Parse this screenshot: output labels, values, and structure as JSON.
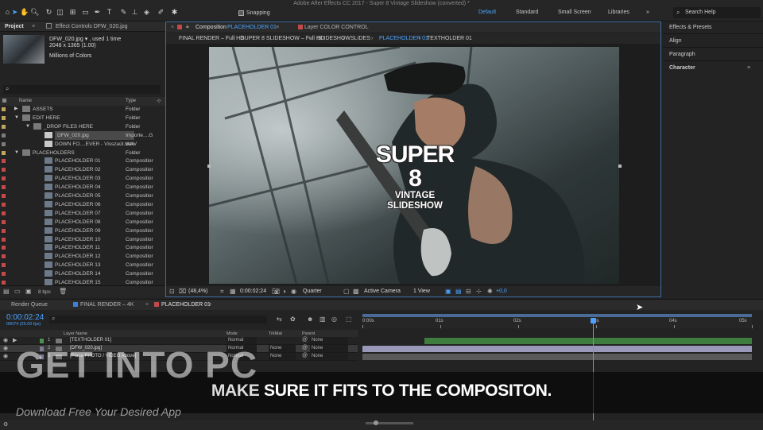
{
  "app": {
    "title": "Adobe After Effects CC 2017 - Super 8 Vintage Slideshow (converted) *"
  },
  "toolbar": {
    "snapping": "Snapping",
    "workspaces": [
      "Default",
      "Standard",
      "Small Screen",
      "Libraries"
    ],
    "search_placeholder": "Search Help"
  },
  "project": {
    "tab": "Project",
    "effect_controls": "Effect Controls DFW_020.jpg",
    "thumb_name": "DFW_020.jpg ▾ , used 1 time",
    "thumb_dims": "2048 x 1365 (1.00)",
    "thumb_colors": "Millions of Colors",
    "col_name": "Name",
    "col_type": "Type",
    "bpc": "8 bpc",
    "items": [
      {
        "name": "ASSETS",
        "type": "Folder",
        "label": "#c0a85a",
        "kind": "folder",
        "indent": 0
      },
      {
        "name": "EDIT HERE",
        "type": "Folder",
        "label": "#c0a85a",
        "kind": "folder",
        "indent": 0
      },
      {
        "name": "_DROP FILES HERE",
        "type": "Folder",
        "label": "#c0a85a",
        "kind": "folder",
        "indent": 1
      },
      {
        "name": "DFW_020.jpg",
        "type": "Importe....G",
        "label": "#7d7d7d",
        "kind": "file",
        "indent": 2
      },
      {
        "name": "DOWN FO....EVER - Visszaút.wav",
        "type": "WAV",
        "label": "#7d7d7d",
        "kind": "file",
        "indent": 2
      },
      {
        "name": "PLACEHOLDERS",
        "type": "Folder",
        "label": "#c0a85a",
        "kind": "folder",
        "indent": 0
      },
      {
        "name": "PLACEHOLDER 01",
        "type": "Compositior",
        "label": "#c44a4a",
        "kind": "comp",
        "indent": 2
      },
      {
        "name": "PLACEHOLDER 02",
        "type": "Compositior",
        "label": "#c44a4a",
        "kind": "comp",
        "indent": 2
      },
      {
        "name": "PLACEHOLDER 03",
        "type": "Compositior",
        "label": "#c44a4a",
        "kind": "comp",
        "indent": 2
      },
      {
        "name": "PLACEHOLDER 04",
        "type": "Compositior",
        "label": "#c44a4a",
        "kind": "comp",
        "indent": 2
      },
      {
        "name": "PLACEHOLDER 05",
        "type": "Compositior",
        "label": "#c44a4a",
        "kind": "comp",
        "indent": 2
      },
      {
        "name": "PLACEHOLDER 06",
        "type": "Compositior",
        "label": "#c44a4a",
        "kind": "comp",
        "indent": 2
      },
      {
        "name": "PLACEHOLDER 07",
        "type": "Compositior",
        "label": "#c44a4a",
        "kind": "comp",
        "indent": 2
      },
      {
        "name": "PLACEHOLDER 08",
        "type": "Compositior",
        "label": "#c44a4a",
        "kind": "comp",
        "indent": 2
      },
      {
        "name": "PLACEHOLDER 09",
        "type": "Compositior",
        "label": "#c44a4a",
        "kind": "comp",
        "indent": 2
      },
      {
        "name": "PLACEHOLDER 10",
        "type": "Compositior",
        "label": "#c44a4a",
        "kind": "comp",
        "indent": 2
      },
      {
        "name": "PLACEHOLDER 11",
        "type": "Compositior",
        "label": "#c44a4a",
        "kind": "comp",
        "indent": 2
      },
      {
        "name": "PLACEHOLDER 12",
        "type": "Compositior",
        "label": "#c44a4a",
        "kind": "comp",
        "indent": 2
      },
      {
        "name": "PLACEHOLDER 13",
        "type": "Compositior",
        "label": "#c44a4a",
        "kind": "comp",
        "indent": 2
      },
      {
        "name": "PLACEHOLDER 14",
        "type": "Compositior",
        "label": "#c44a4a",
        "kind": "comp",
        "indent": 2
      },
      {
        "name": "PLACEHOLDER 15",
        "type": "Compositior",
        "label": "#c44a4a",
        "kind": "comp",
        "indent": 2
      }
    ]
  },
  "viewer": {
    "comp_tab_prefix": "Composition",
    "comp_tab_name": "PLACEHOLDER 01",
    "layer_tab": "Layer COLOR CONTROL",
    "breadcrumbs": [
      "FINAL RENDER – Full HD",
      "SUPER 8 SLIDESHOW – Full HD",
      "SLIDESHOW",
      "SLIDES",
      "PLACEHOLDER 01",
      "TEXTHOLDER 01"
    ],
    "title_line1": "SUPER 8",
    "title_line2": "VINTAGE SLIDESHOW",
    "zoom": "(48,4%)",
    "timecode": "0:00:02:24",
    "resolution": "Quarter",
    "camera": "Active Camera",
    "views": "1 View",
    "exposure": "+0,0"
  },
  "right": {
    "panels": [
      "Effects & Presets",
      "Align",
      "Paragraph",
      "Character"
    ]
  },
  "timeline": {
    "tabs": [
      "Render Queue",
      "FINAL RENDER – 4K",
      "PLACEHOLDER 01"
    ],
    "timecode": "0:00:02:24",
    "frames": "00074 (25.00 fps)",
    "col_layer": "Layer Name",
    "col_mode": "Mode",
    "col_trkmat": "TrkMat",
    "col_parent": "Parent",
    "ruler": [
      "0:00s",
      "01s",
      "02s",
      "03s",
      "04s",
      "05s"
    ],
    "playhead": 2.96,
    "duration": 5,
    "layers": [
      {
        "num": "1",
        "name": "[TEXTHOLDER 01]",
        "mode": "Normal",
        "trkmat": "",
        "parent": "None",
        "label": "#4e8f4e",
        "bar_color": "#3f7d3f",
        "start": 0.8,
        "end": 5
      },
      {
        "num": "2",
        "name": "[DFW_020.jpg]",
        "mode": "Normal",
        "trkmat": "None",
        "parent": "None",
        "label": "#7d7d9a",
        "bar_color": "#9a98b8",
        "start": 0,
        "end": 5
      },
      {
        "num": "3",
        "name": "[Place PHOTO / VIDEO Above]",
        "mode": "Normal",
        "trkmat": "None",
        "parent": "None",
        "label": "#7d7d9a",
        "bar_color": "#5a5a5a",
        "start": 0,
        "end": 5
      }
    ]
  },
  "overlay": {
    "subtitle": "MAKE SURE IT FITS TO THE COMPOSITON.",
    "subtitle_em": "MAKE",
    "watermark": "GET INTO PC",
    "watermark_sub": "Download Free Your Desired App"
  },
  "colors": {
    "accent": "#3a82d9",
    "panel": "#232323",
    "comp_red": "#c44a4a"
  }
}
